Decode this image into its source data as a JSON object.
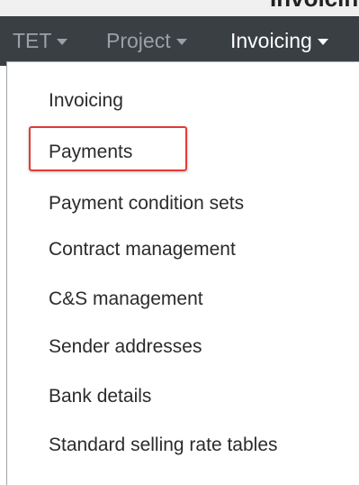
{
  "top_strip": {
    "partial_text": "Invoicing"
  },
  "navbar": {
    "items": [
      {
        "label": "TET"
      },
      {
        "label": "Project"
      },
      {
        "label": "Invoicing"
      }
    ]
  },
  "dropdown": {
    "items": [
      {
        "label": "Invoicing"
      },
      {
        "label": "Payments"
      },
      {
        "label": "Payment condition sets"
      },
      {
        "label": "Contract management"
      },
      {
        "label": "C&S management"
      },
      {
        "label": "Sender addresses"
      },
      {
        "label": "Bank details"
      },
      {
        "label": "Standard selling rate tables"
      }
    ],
    "highlighted_item": "Payments"
  },
  "colors": {
    "navbar_bg": "#3a3f44",
    "nav_inactive": "#9aa0a6",
    "nav_active": "#ffffff",
    "highlight_border": "#e53935"
  }
}
